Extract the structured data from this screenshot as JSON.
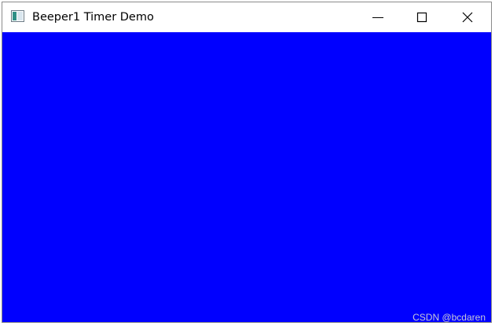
{
  "window": {
    "title": "Beeper1 Timer Demo",
    "icon": "app-window-icon",
    "client_background": "#0000ff"
  },
  "controls": {
    "minimize_icon": "minimize-icon",
    "maximize_icon": "maximize-icon",
    "close_icon": "close-icon"
  },
  "watermark": {
    "text": "CSDN @bcdaren"
  }
}
